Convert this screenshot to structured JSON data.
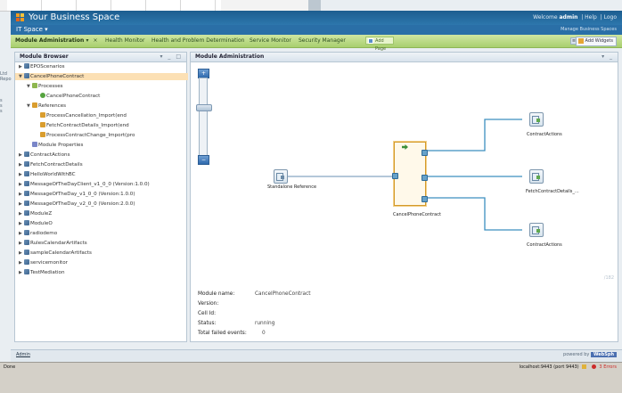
{
  "background_window": {
    "side_text": [
      "Ltd",
      "Repo",
      "s",
      "s",
      "s"
    ]
  },
  "header": {
    "app_title": "Your Business Space",
    "welcome_prefix": "Welcome",
    "user": "admin",
    "links": [
      "Help",
      "Logo"
    ],
    "space_name": "IT Space ▾",
    "manage_spaces": "Manage Business Spaces",
    "colors": {
      "header": "#1c5d8f",
      "tabbar": "#a8cf6e"
    }
  },
  "tabs": [
    {
      "label": "Module Administration",
      "active": true
    },
    {
      "label": "Health Monitor",
      "active": false
    },
    {
      "label": "Health and Problem Determination",
      "active": false
    },
    {
      "label": "Service Monitor",
      "active": false
    },
    {
      "label": "Security Manager",
      "active": false
    }
  ],
  "tab_menu_glyph": "▾",
  "tab_close_glyph": "×",
  "add_page_label": "Add Page",
  "menu_toggle_glyph": "≡",
  "add_widgets_label": "Add Widgets",
  "module_browser": {
    "title": "Module Browser",
    "controls": "▾ _ □",
    "items": [
      {
        "indent": 0,
        "twisty": "▶",
        "icon": "mod",
        "label": "EPOScenarios"
      },
      {
        "indent": 0,
        "twisty": "▼",
        "icon": "mod",
        "label": "CancelPhoneContract",
        "selected": true
      },
      {
        "indent": 1,
        "twisty": "▼",
        "icon": "grp",
        "label": "Processes"
      },
      {
        "indent": 2,
        "twisty": "",
        "icon": "prc",
        "label": "CancelPhoneContract"
      },
      {
        "indent": 1,
        "twisty": "▼",
        "icon": "ref",
        "label": "References"
      },
      {
        "indent": 2,
        "twisty": "",
        "icon": "ref",
        "label": "ProcessCancellation_Import(end"
      },
      {
        "indent": 2,
        "twisty": "",
        "icon": "ref",
        "label": "FetchContractDetails_Import(end"
      },
      {
        "indent": 2,
        "twisty": "",
        "icon": "ref",
        "label": "ProcessContractChange_Import(pro"
      },
      {
        "indent": 1,
        "twisty": "",
        "icon": "prop",
        "label": "Module Properties"
      },
      {
        "indent": 0,
        "twisty": "▶",
        "icon": "mod",
        "label": "ContractActions"
      },
      {
        "indent": 0,
        "twisty": "▶",
        "icon": "mod",
        "label": "FetchContractDetails"
      },
      {
        "indent": 0,
        "twisty": "▶",
        "icon": "mod",
        "label": "HelloWorldWithBC"
      },
      {
        "indent": 0,
        "twisty": "▶",
        "icon": "mod",
        "label": "MessageOfTheDayClient_v1_0_0 (Version:1.0.0)"
      },
      {
        "indent": 0,
        "twisty": "▶",
        "icon": "mod",
        "label": "MessageOfTheDay_v1_0_0 (Version:1.0.0)"
      },
      {
        "indent": 0,
        "twisty": "▶",
        "icon": "mod",
        "label": "MessageOfTheDay_v2_0_0 (Version:2.0.0)"
      },
      {
        "indent": 0,
        "twisty": "▶",
        "icon": "mod",
        "label": "ModuleZ"
      },
      {
        "indent": 0,
        "twisty": "▶",
        "icon": "mod",
        "label": "ModuleO"
      },
      {
        "indent": 0,
        "twisty": "▶",
        "icon": "mod",
        "label": "radiodemo"
      },
      {
        "indent": 0,
        "twisty": "▶",
        "icon": "mod",
        "label": "RulesCalendarArtifacts"
      },
      {
        "indent": 0,
        "twisty": "▶",
        "icon": "mod",
        "label": "sampleCalendarArtifacts"
      },
      {
        "indent": 0,
        "twisty": "▶",
        "icon": "mod",
        "label": "servicemonitor"
      },
      {
        "indent": 0,
        "twisty": "▶",
        "icon": "mod",
        "label": "TestMediation"
      }
    ]
  },
  "module_admin": {
    "title": "Module Administration",
    "controls": "▾ _",
    "zoom_plus": "+",
    "zoom_minus": "−",
    "diagram": {
      "source_label": "Standalone Reference",
      "module_label": "CancelPhoneContract",
      "targets": [
        "ContractActions",
        "FetchContractDetails_...",
        "ContractActions"
      ]
    },
    "watermark": "/182",
    "properties": [
      {
        "key": "Module name:",
        "value": "CancelPhoneContract"
      },
      {
        "key": "Version:",
        "value": ""
      },
      {
        "key": "Cell Id:",
        "value": ""
      },
      {
        "key": "Status:",
        "value": "running"
      },
      {
        "key": "Total failed events:",
        "value": "0"
      }
    ]
  },
  "footer": {
    "left": "Admin",
    "powered_by": "powered by",
    "powered_brand": "WebSph"
  },
  "statusbar": {
    "left": "Done",
    "url": "localhost:9443 (port 9443)",
    "errors": "3 Errors"
  }
}
